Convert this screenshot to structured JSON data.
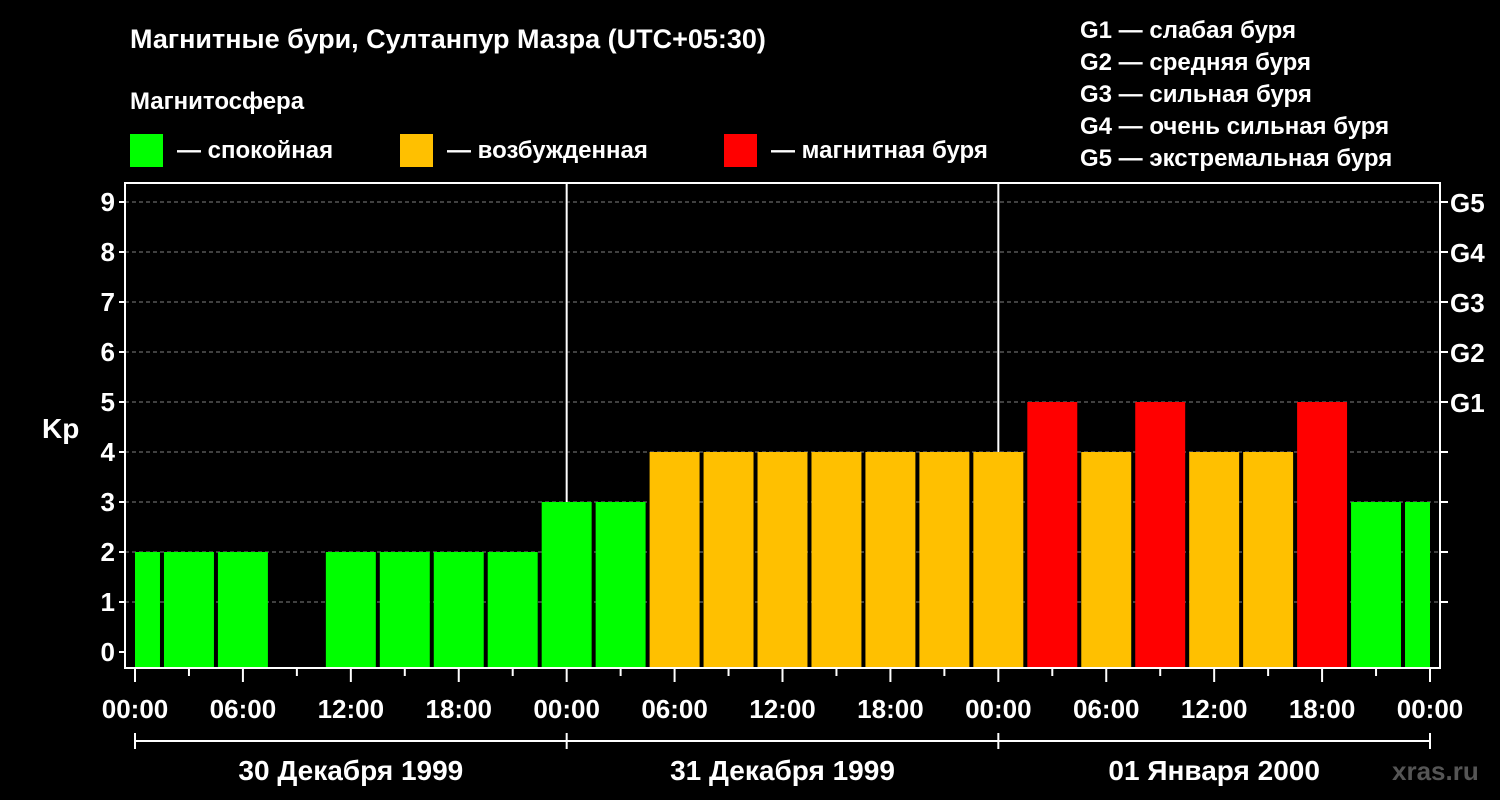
{
  "title": "Магнитные бури, Султанпур Мазра (UTC+05:30)",
  "legend": {
    "heading": "Магнитосфера",
    "items": [
      {
        "label": "— спокойная",
        "color": "#00ff00"
      },
      {
        "label": "— возбужденная",
        "color": "#ffc000"
      },
      {
        "label": "— магнитная буря",
        "color": "#ff0000"
      }
    ]
  },
  "g_scale": [
    "G1 — слабая буря",
    "G2 — средняя буря",
    "G3 — сильная буря",
    "G4 — очень сильная буря",
    "G5 — экстремальная буря"
  ],
  "watermark": "xras.ru",
  "colors": {
    "quiet": "#00ff00",
    "active": "#ffc000",
    "storm": "#ff0000",
    "background": "#000000",
    "grid": "#7f7f7f",
    "axis": "#ffffff"
  },
  "chart_data": {
    "type": "bar",
    "ylabel": "Kp",
    "ylim": [
      0,
      9
    ],
    "y_ticks": [
      0,
      1,
      2,
      3,
      4,
      5,
      6,
      7,
      8,
      9
    ],
    "right_ticks": [
      {
        "value": 5,
        "label": "G1"
      },
      {
        "value": 6,
        "label": "G2"
      },
      {
        "value": 7,
        "label": "G3"
      },
      {
        "value": 8,
        "label": "G4"
      },
      {
        "value": 9,
        "label": "G5"
      }
    ],
    "grid": "dashed horizontal",
    "x_tick_labels": [
      "00:00",
      "06:00",
      "12:00",
      "18:00",
      "00:00",
      "06:00",
      "12:00",
      "18:00",
      "00:00",
      "06:00",
      "12:00",
      "18:00",
      "00:00"
    ],
    "days": [
      "30 Декабря 1999",
      "31 Декабря 1999",
      "01 Января 2000"
    ],
    "bar_period_hours": 3,
    "first_bar_start_hours": -1.5,
    "values": [
      2,
      2,
      2,
      0,
      2,
      2,
      2,
      2,
      3,
      3,
      4,
      4,
      4,
      4,
      4,
      4,
      4,
      5,
      4,
      5,
      4,
      4,
      5,
      3,
      3
    ],
    "categories": [
      "quiet",
      "quiet",
      "quiet",
      "quiet",
      "quiet",
      "quiet",
      "quiet",
      "quiet",
      "quiet",
      "quiet",
      "active",
      "active",
      "active",
      "active",
      "active",
      "active",
      "active",
      "storm",
      "active",
      "storm",
      "active",
      "active",
      "storm",
      "quiet",
      "quiet"
    ]
  }
}
